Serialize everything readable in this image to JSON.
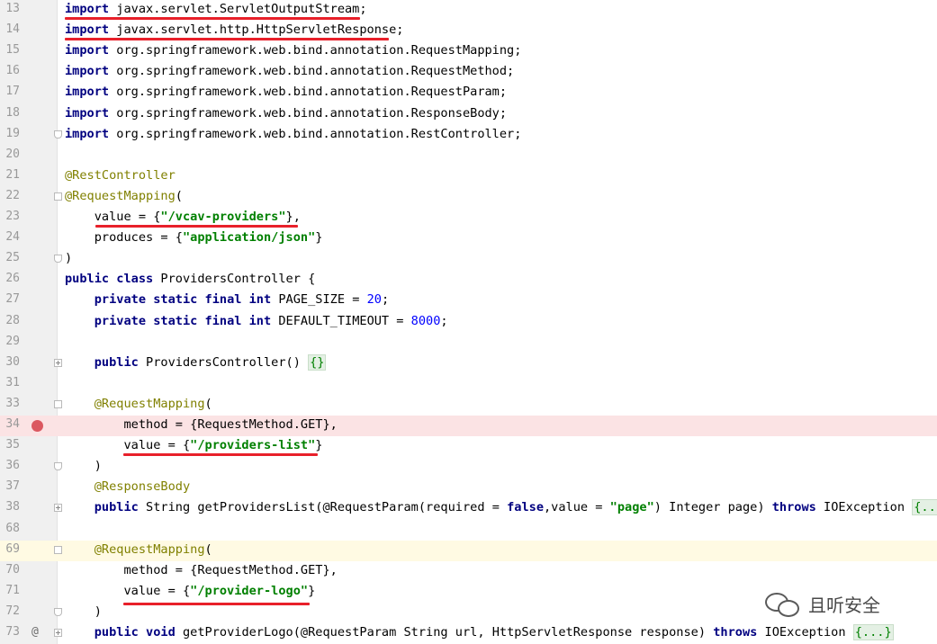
{
  "editor": {
    "lines": [
      {
        "n": "13",
        "parts": [
          [
            "kw",
            "import"
          ],
          [
            "t",
            " javax.servlet.ServletOutputStream;"
          ]
        ]
      },
      {
        "n": "14",
        "parts": [
          [
            "kw",
            "import"
          ],
          [
            "t",
            " javax.servlet.http.HttpServletResponse;"
          ]
        ]
      },
      {
        "n": "15",
        "parts": [
          [
            "kw",
            "import"
          ],
          [
            "t",
            " org.springframework.web.bind.annotation.RequestMapping;"
          ]
        ]
      },
      {
        "n": "16",
        "parts": [
          [
            "kw",
            "import"
          ],
          [
            "t",
            " org.springframework.web.bind.annotation.RequestMethod;"
          ]
        ]
      },
      {
        "n": "17",
        "parts": [
          [
            "kw",
            "import"
          ],
          [
            "t",
            " org.springframework.web.bind.annotation.RequestParam;"
          ]
        ]
      },
      {
        "n": "18",
        "parts": [
          [
            "kw",
            "import"
          ],
          [
            "t",
            " org.springframework.web.bind.annotation.ResponseBody;"
          ]
        ]
      },
      {
        "n": "19",
        "parts": [
          [
            "kw",
            "import"
          ],
          [
            "t",
            " org.springframework.web.bind.annotation.RestController;"
          ]
        ]
      },
      {
        "n": "20",
        "parts": []
      },
      {
        "n": "21",
        "parts": [
          [
            "ann",
            "@RestController"
          ]
        ]
      },
      {
        "n": "22",
        "parts": [
          [
            "ann",
            "@RequestMapping"
          ],
          [
            "t",
            "("
          ]
        ]
      },
      {
        "n": "23",
        "parts": [
          [
            "t",
            "    value = {"
          ],
          [
            "str",
            "\"/vcav-providers\""
          ],
          [
            "t",
            "},"
          ]
        ]
      },
      {
        "n": "24",
        "parts": [
          [
            "t",
            "    produces = {"
          ],
          [
            "str",
            "\"application/json\""
          ],
          [
            "t",
            "}"
          ]
        ]
      },
      {
        "n": "25",
        "parts": [
          [
            "t",
            ")"
          ]
        ]
      },
      {
        "n": "26",
        "parts": [
          [
            "kw",
            "public class"
          ],
          [
            "t",
            " ProvidersController {"
          ]
        ]
      },
      {
        "n": "27",
        "parts": [
          [
            "t",
            "    "
          ],
          [
            "kw",
            "private static final int"
          ],
          [
            "t",
            " PAGE_SIZE = "
          ],
          [
            "num",
            "20"
          ],
          [
            "t",
            ";"
          ]
        ]
      },
      {
        "n": "28",
        "parts": [
          [
            "t",
            "    "
          ],
          [
            "kw",
            "private static final int"
          ],
          [
            "t",
            " DEFAULT_TIMEOUT = "
          ],
          [
            "num",
            "8000"
          ],
          [
            "t",
            ";"
          ]
        ]
      },
      {
        "n": "29",
        "parts": []
      },
      {
        "n": "30",
        "parts": [
          [
            "t",
            "    "
          ],
          [
            "kw",
            "public"
          ],
          [
            "t",
            " ProvidersController() "
          ],
          [
            "fold",
            "{}"
          ]
        ]
      },
      {
        "n": "31",
        "parts": []
      },
      {
        "n": "33",
        "parts": [
          [
            "t",
            "    "
          ],
          [
            "ann",
            "@RequestMapping"
          ],
          [
            "t",
            "("
          ]
        ]
      },
      {
        "n": "34",
        "parts": [
          [
            "t",
            "        method = {RequestMethod.GET},"
          ]
        ]
      },
      {
        "n": "35",
        "parts": [
          [
            "t",
            "        value = {"
          ],
          [
            "str",
            "\"/providers-list\""
          ],
          [
            "t",
            "}"
          ]
        ]
      },
      {
        "n": "36",
        "parts": [
          [
            "t",
            "    )"
          ]
        ]
      },
      {
        "n": "37",
        "parts": [
          [
            "t",
            "    "
          ],
          [
            "ann",
            "@ResponseBody"
          ]
        ]
      },
      {
        "n": "38",
        "parts": [
          [
            "t",
            "    "
          ],
          [
            "kw",
            "public"
          ],
          [
            "t",
            " String getProvidersList(@RequestParam(required = "
          ],
          [
            "kw",
            "false"
          ],
          [
            "t",
            ",value = "
          ],
          [
            "str",
            "\"page\""
          ],
          [
            "t",
            ") Integer page) "
          ],
          [
            "kw",
            "throws"
          ],
          [
            "t",
            " IOException "
          ],
          [
            "fold",
            "{...}"
          ]
        ]
      },
      {
        "n": "68",
        "parts": []
      },
      {
        "n": "69",
        "parts": [
          [
            "t",
            "    "
          ],
          [
            "ann",
            "@RequestMapping"
          ],
          [
            "t",
            "("
          ]
        ]
      },
      {
        "n": "70",
        "parts": [
          [
            "t",
            "        method = {RequestMethod.GET},"
          ]
        ]
      },
      {
        "n": "71",
        "parts": [
          [
            "t",
            "        value = {"
          ],
          [
            "str",
            "\"/provider-logo\""
          ],
          [
            "t",
            "}"
          ]
        ]
      },
      {
        "n": "72",
        "parts": [
          [
            "t",
            "    )"
          ]
        ]
      },
      {
        "n": "73",
        "parts": [
          [
            "t",
            "    "
          ],
          [
            "kw",
            "public void"
          ],
          [
            "t",
            " getProviderLogo(@RequestParam String url, HttpServletResponse response) "
          ],
          [
            "kw",
            "throws"
          ],
          [
            "t",
            " IOException "
          ],
          [
            "fold",
            "{...}"
          ]
        ]
      }
    ],
    "gutter_icons": {
      "breakpoint_line": "34",
      "override_line": "73",
      "override_icon": "@"
    },
    "highlight": {
      "breakpoint_line": "34",
      "caret_line": "69"
    }
  },
  "watermark": {
    "text": "且听安全",
    "icon": "wechat-icon"
  },
  "colors": {
    "keyword": "#000080",
    "string": "#008000",
    "annotation": "#808000",
    "number": "#0000ff",
    "underline": "#e8202a",
    "breakpoint": "#db5860"
  }
}
